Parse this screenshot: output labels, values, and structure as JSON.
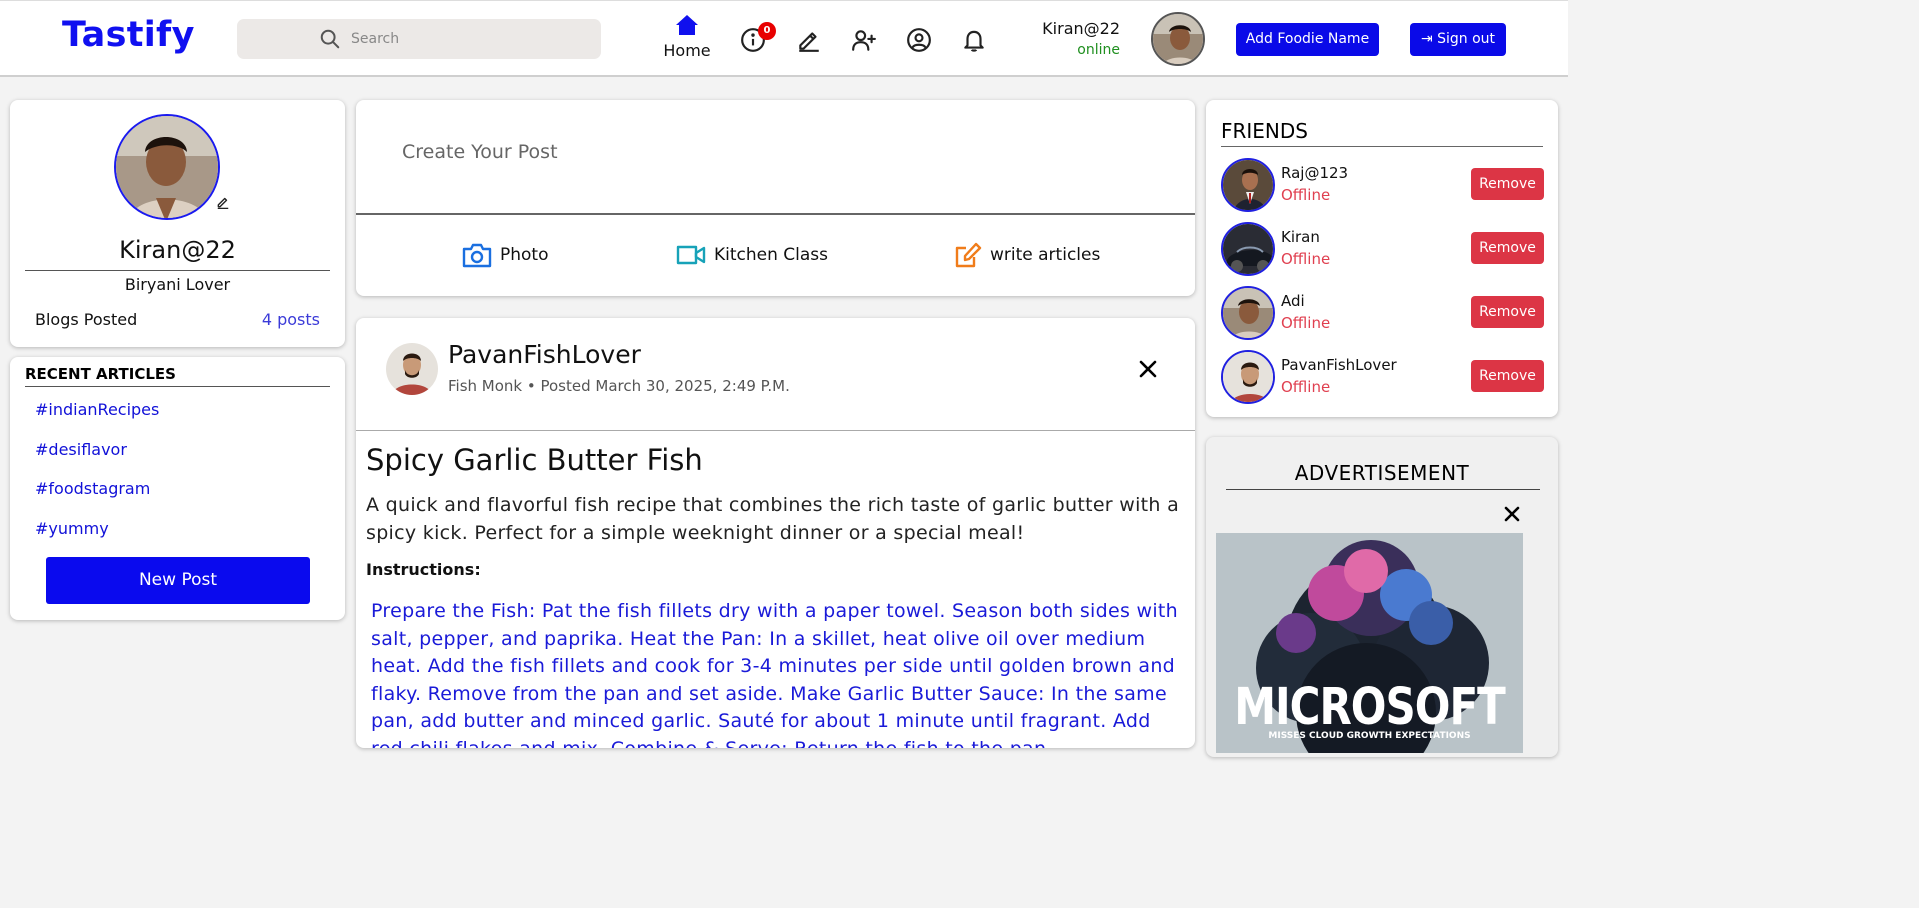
{
  "app": {
    "brand": "Tastify"
  },
  "nav": {
    "search_placeholder": "Search",
    "home_label": "Home",
    "notification_count": "0",
    "icons": [
      "home-icon",
      "info-icon",
      "pencil-icon",
      "add-friend-icon",
      "profile-icon",
      "bell-icon"
    ],
    "user_name": "Kiran@22",
    "user_status": "online",
    "add_foodie_label": "Add Foodie Name",
    "sign_out_label": "Sign out"
  },
  "profile": {
    "name": "Kiran@22",
    "tagline": "Biryani Lover",
    "blogs_label": "Blogs Posted",
    "posts_count": "4 posts"
  },
  "recent_articles": {
    "title": "RECENT ARTICLES",
    "tags": [
      "#indianRecipes",
      "#desiflavor",
      "#foodstagram",
      "#yummy"
    ],
    "new_post_label": "New Post"
  },
  "create_post": {
    "placeholder": "Create Your Post",
    "actions": [
      {
        "label": "Photo",
        "icon": "camera-icon",
        "color": "#1a6fe0"
      },
      {
        "label": "Kitchen Class",
        "icon": "video-icon",
        "color": "#17a2b8"
      },
      {
        "label": "write articles",
        "icon": "edit-icon",
        "color": "#f07c1a"
      }
    ]
  },
  "post": {
    "author": "PavanFishLover",
    "meta": "Fish Monk • Posted March 30, 2025, 2:49 P.M.",
    "title": "Spicy Garlic Butter Fish",
    "description": "A quick and flavorful fish recipe that combines the rich taste of garlic butter with a spicy kick. Perfect for a simple weeknight dinner or a special meal!",
    "instructions_heading": "Instructions:",
    "instructions": "Prepare the Fish: Pat the fish fillets dry with a paper towel. Season both sides with salt, pepper, and paprika. Heat the Pan: In a skillet, heat olive oil over medium heat. Add the fish fillets and cook for 3-4 minutes per side until golden brown and flaky. Remove from the pan and set aside. Make Garlic Butter Sauce: In the same pan, add butter and minced garlic. Sauté for about 1 minute until fragrant. Add red chili flakes and mix. Combine & Serve: Return the fish to the pan."
  },
  "friends": {
    "title": "FRIENDS",
    "remove_label": "Remove",
    "items": [
      {
        "name": "Raj@123",
        "status": "Offline"
      },
      {
        "name": "Kiran",
        "status": "Offline"
      },
      {
        "name": "Adi",
        "status": "Offline"
      },
      {
        "name": "PavanFishLover",
        "status": "Offline"
      }
    ]
  },
  "advertisement": {
    "title": "ADVERTISEMENT",
    "headline": "MICROSOFT",
    "subline": "MISSES CLOUD GROWTH EXPECTATIONS"
  },
  "colors": {
    "brand": "#1010f0",
    "primary_button": "#0a0ae8",
    "danger": "#dc3545",
    "online": "#1f8f1f",
    "offline": "#e04050",
    "link": "#1111d8"
  }
}
